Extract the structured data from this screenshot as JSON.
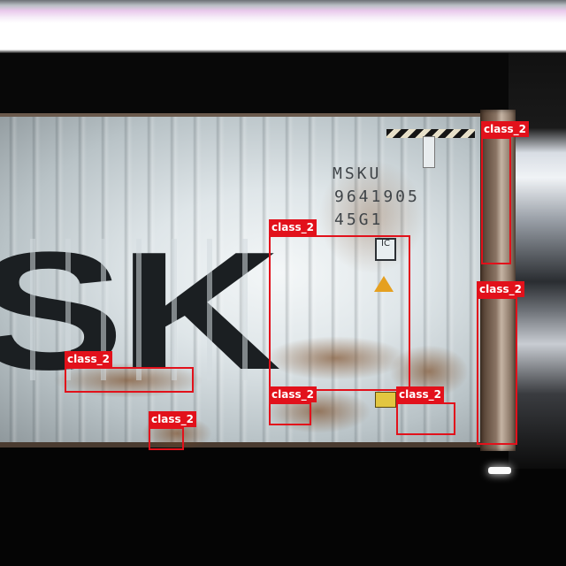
{
  "container": {
    "owner_code": "MSKU",
    "serial_number": "9641905",
    "type_code": "45G1",
    "brand_fragment": "SK",
    "ic_mark": "IC"
  },
  "detections": [
    {
      "label": "class_2"
    },
    {
      "label": "class_2"
    },
    {
      "label": "class_2"
    },
    {
      "label": "class_2"
    },
    {
      "label": "class_2"
    },
    {
      "label": "class_2"
    },
    {
      "label": "class_2"
    },
    {
      "label": "class_2"
    }
  ],
  "colors": {
    "bbox": "#e2111b",
    "label_text": "#ffffff"
  }
}
